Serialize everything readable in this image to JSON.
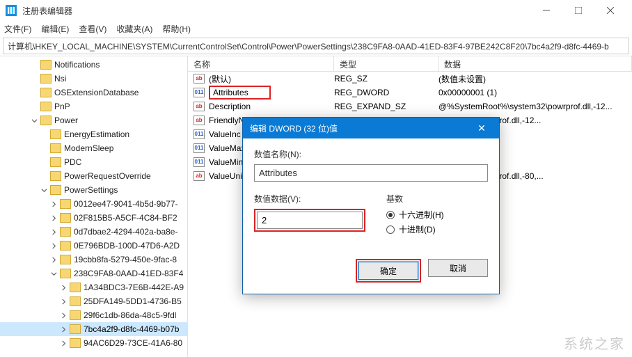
{
  "window": {
    "title": "注册表编辑器"
  },
  "menu": {
    "file": "文件(F)",
    "edit": "编辑(E)",
    "view": "查看(V)",
    "fav": "收藏夹(A)",
    "help": "帮助(H)"
  },
  "path": "计算机\\HKEY_LOCAL_MACHINE\\SYSTEM\\CurrentControlSet\\Control\\Power\\PowerSettings\\238C9FA8-0AAD-41ED-83F4-97BE242C8F20\\7bc4a2f9-d8fc-4469-b",
  "tree": {
    "items": [
      {
        "indent": 3,
        "tw": "",
        "label": "Notifications"
      },
      {
        "indent": 3,
        "tw": "",
        "label": "Nsi"
      },
      {
        "indent": 3,
        "tw": "",
        "label": "OSExtensionDatabase"
      },
      {
        "indent": 3,
        "tw": "",
        "label": "PnP"
      },
      {
        "indent": 3,
        "tw": "open",
        "label": "Power"
      },
      {
        "indent": 4,
        "tw": "",
        "label": "EnergyEstimation"
      },
      {
        "indent": 4,
        "tw": "",
        "label": "ModernSleep"
      },
      {
        "indent": 4,
        "tw": "",
        "label": "PDC"
      },
      {
        "indent": 4,
        "tw": "",
        "label": "PowerRequestOverride"
      },
      {
        "indent": 4,
        "tw": "open",
        "label": "PowerSettings"
      },
      {
        "indent": 5,
        "tw": "closed",
        "label": "0012ee47-9041-4b5d-9b77-"
      },
      {
        "indent": 5,
        "tw": "closed",
        "label": "02F815B5-A5CF-4C84-BF2"
      },
      {
        "indent": 5,
        "tw": "closed",
        "label": "0d7dbae2-4294-402a-ba8e-"
      },
      {
        "indent": 5,
        "tw": "closed",
        "label": "0E796BDB-100D-47D6-A2D"
      },
      {
        "indent": 5,
        "tw": "closed",
        "label": "19cbb8fa-5279-450e-9fac-8"
      },
      {
        "indent": 5,
        "tw": "open",
        "label": "238C9FA8-0AAD-41ED-83F4"
      },
      {
        "indent": 6,
        "tw": "closed",
        "label": "1A34BDC3-7E6B-442E-A9"
      },
      {
        "indent": 6,
        "tw": "closed",
        "label": "25DFA149-5DD1-4736-B5"
      },
      {
        "indent": 6,
        "tw": "closed",
        "label": "29f6c1db-86da-48c5-9fdl"
      },
      {
        "indent": 6,
        "tw": "closed",
        "label": "7bc4a2f9-d8fc-4469-b07b",
        "selected": true
      },
      {
        "indent": 6,
        "tw": "closed",
        "label": "94AC6D29-73CE-41A6-80"
      }
    ]
  },
  "list": {
    "headers": {
      "name": "名称",
      "type": "类型",
      "data": "数据"
    },
    "rows": [
      {
        "icon": "str",
        "name": "(默认)",
        "type": "REG_SZ",
        "data": "(数值未设置)"
      },
      {
        "icon": "bin",
        "name": "Attributes",
        "type": "REG_DWORD",
        "data": "0x00000001 (1)",
        "highlight": true
      },
      {
        "icon": "str",
        "name": "Description",
        "type": "REG_EXPAND_SZ",
        "data": "@%SystemRoot%\\system32\\powrprof.dll,-12..."
      },
      {
        "icon": "str",
        "name": "FriendlyName",
        "type": "",
        "data": "system32\\powrprof.dll,-12..."
      },
      {
        "icon": "bin",
        "name": "ValueInc",
        "type": "",
        "data": ""
      },
      {
        "icon": "bin",
        "name": "ValueMax",
        "type": "",
        "data": ""
      },
      {
        "icon": "bin",
        "name": "ValueMin",
        "type": "",
        "data": ""
      },
      {
        "icon": "str",
        "name": "ValueUnits",
        "type": "",
        "data": "system32\\powrprof.dll,-80,..."
      }
    ]
  },
  "dialog": {
    "title": "编辑 DWORD (32 位)值",
    "name_label": "数值名称(N):",
    "name_value": "Attributes",
    "data_label": "数值数据(V):",
    "data_value": "2",
    "base_label": "基数",
    "hex": "十六进制(H)",
    "dec": "十进制(D)",
    "ok": "确定",
    "cancel": "取消"
  },
  "watermark": "系统之家"
}
